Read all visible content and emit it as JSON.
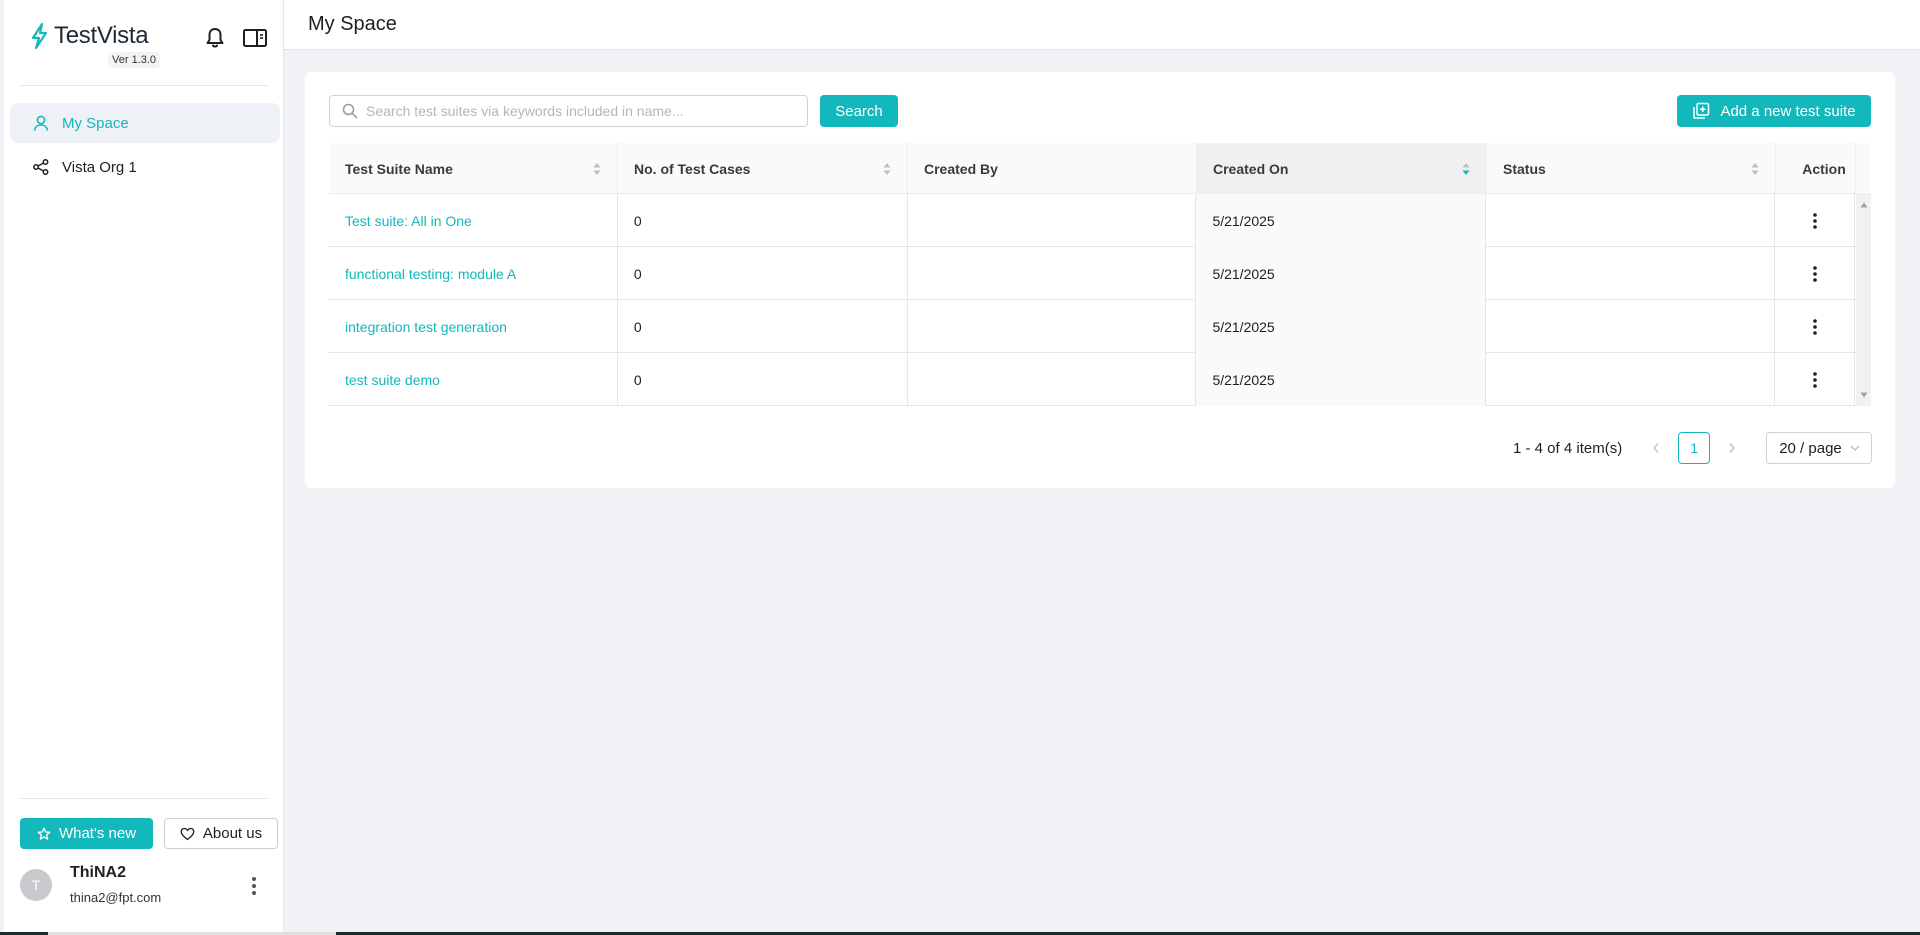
{
  "app": {
    "name": "TestVista",
    "version": "Ver 1.3.0"
  },
  "sidebar": {
    "items": [
      {
        "label": "My Space",
        "icon": "user-icon",
        "active": true
      },
      {
        "label": "Vista Org 1",
        "icon": "share-icon",
        "active": false
      }
    ],
    "whats_new_label": "What's new",
    "about_label": "About us"
  },
  "user": {
    "initial": "T",
    "name": "ThiNA2",
    "email": "thina2@fpt.com"
  },
  "header": {
    "title": "My Space"
  },
  "toolbar": {
    "search_placeholder": "Search test suites via keywords included in name...",
    "search_value": "",
    "search_label": "Search",
    "add_label": "Add a new test suite"
  },
  "table": {
    "columns": [
      "Test Suite Name",
      "No. of Test Cases",
      "Created By",
      "Created On",
      "Status",
      "Action"
    ],
    "sorted_column": "Created On",
    "rows": [
      {
        "name": "Test suite: All in One",
        "cases": "0",
        "created_by": "",
        "created_on": "5/21/2025",
        "status": ""
      },
      {
        "name": "functional testing: module A",
        "cases": "0",
        "created_by": "",
        "created_on": "5/21/2025",
        "status": ""
      },
      {
        "name": "integration test generation",
        "cases": "0",
        "created_by": "",
        "created_on": "5/21/2025",
        "status": ""
      },
      {
        "name": "test suite demo",
        "cases": "0",
        "created_by": "",
        "created_on": "5/21/2025",
        "status": ""
      }
    ]
  },
  "pagination": {
    "range": "1 - 4 of 4 item(s)",
    "current_page": "1",
    "page_size": "20 / page"
  },
  "colors": {
    "accent": "#13b8bd",
    "background": "#f0f2f5"
  }
}
